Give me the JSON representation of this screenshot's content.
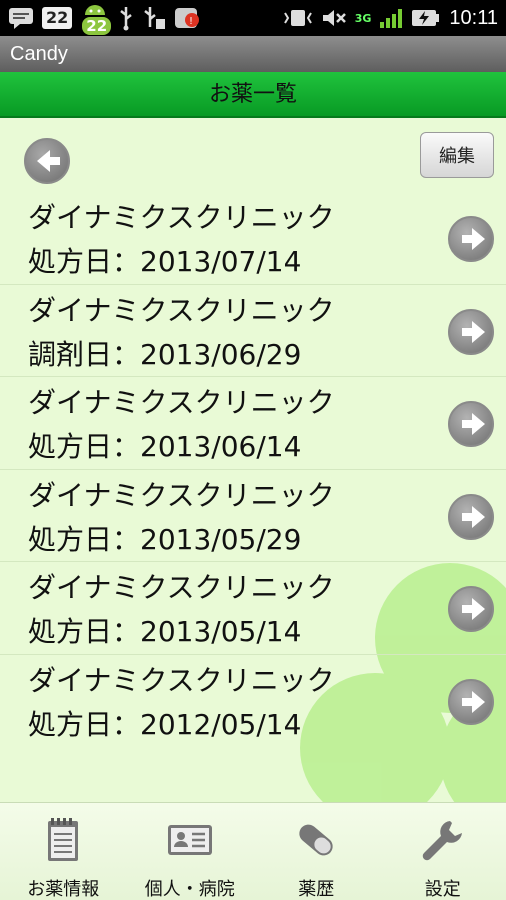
{
  "status_bar": {
    "notification_count_1": "22",
    "notification_count_2": "22",
    "network": "3G",
    "time": "10:11"
  },
  "app": {
    "title": "Candy",
    "header": "お薬一覧"
  },
  "toolbar": {
    "edit_label": "編集"
  },
  "prescriptions": [
    {
      "clinic": "ダイナミクスクリニック",
      "date_line": "処方日：2013/07/14"
    },
    {
      "clinic": "ダイナミクスクリニック",
      "date_line": "調剤日：2013/06/29"
    },
    {
      "clinic": "ダイナミクスクリニック",
      "date_line": "処方日：2013/06/14"
    },
    {
      "clinic": "ダイナミクスクリニック",
      "date_line": "処方日：2013/05/29"
    },
    {
      "clinic": "ダイナミクスクリニック",
      "date_line": "処方日：2013/05/14"
    },
    {
      "clinic": "ダイナミクスクリニック",
      "date_line": "処方日：2012/05/14"
    }
  ],
  "tabs": [
    {
      "label": "お薬情報",
      "icon": "notepad-icon"
    },
    {
      "label": "個人・病院",
      "icon": "id-card-icon"
    },
    {
      "label": "薬歴",
      "icon": "pill-icon"
    },
    {
      "label": "設定",
      "icon": "wrench-icon"
    }
  ],
  "colors": {
    "header_green": "#14b032",
    "content_bg": "#e9fad6",
    "clover": "#b9ef8f"
  }
}
